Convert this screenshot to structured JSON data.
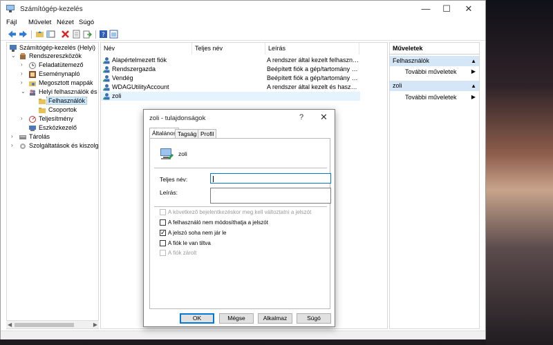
{
  "window": {
    "title": "Számítógép-kezelés",
    "minimize": "—",
    "maximize": "☐",
    "close": "✕"
  },
  "menu": {
    "items": [
      "Fájl",
      "Művelet",
      "Nézet",
      "Súgó"
    ]
  },
  "toolbar": {
    "icons": [
      "back-icon",
      "forward-icon",
      "up-folder-icon",
      "show-hide-tree-icon",
      "delete-icon",
      "properties-icon",
      "export-icon",
      "help-icon",
      "console-icon"
    ]
  },
  "tree": {
    "root": "Számítógép-kezelés (Helyi)",
    "system_tools": "Rendszereszközök",
    "task_scheduler": "Feladatütemező",
    "event_viewer": "Eseménynapló",
    "shared_folders": "Megosztott mappák",
    "local_users_groups": "Helyi felhasználók és cs",
    "users": "Felhasználók",
    "groups": "Csoportok",
    "performance": "Teljesítmény",
    "device_manager": "Eszközkezelő",
    "storage": "Tárolás",
    "services_apps": "Szolgáltatások és kiszolgáló"
  },
  "list": {
    "columns": [
      "Név",
      "Teljes név",
      "Leírás"
    ],
    "rows": [
      {
        "name": "Alapértelmezett fiók",
        "full_name": "",
        "description": "A rendszer által kezelt felhasználói..."
      },
      {
        "name": "Rendszergazda",
        "full_name": "",
        "description": "Beépített fiók a gép/tartomány fel..."
      },
      {
        "name": "Vendég",
        "full_name": "",
        "description": "Beépített fiók a gép/tartomány ve..."
      },
      {
        "name": "WDAGUtilityAccount",
        "full_name": "",
        "description": "A rendszer által kezelt és használt ..."
      },
      {
        "name": "zoli",
        "full_name": "",
        "description": ""
      }
    ]
  },
  "actions": {
    "title": "Műveletek",
    "sections": [
      {
        "header": "Felhasználók",
        "item": "További műveletek"
      },
      {
        "header": "zoli",
        "item": "További műveletek"
      }
    ]
  },
  "dialog": {
    "title": "zoli - tulajdonságok",
    "help": "?",
    "close": "✕",
    "tabs": [
      "Általános",
      "Tagság",
      "Profil"
    ],
    "username": "zoli",
    "full_name_label": "Teljes név:",
    "full_name_value": "",
    "description_label": "Leírás:",
    "description_value": "",
    "checkboxes": [
      {
        "label": "A következő bejelentkezéskor meg kell változtatni a jelszót",
        "checked": false,
        "disabled": true
      },
      {
        "label": "A felhasználó nem módosíthatja a jelszót",
        "checked": false,
        "disabled": false
      },
      {
        "label": "A jelszó soha nem jár le",
        "checked": true,
        "disabled": false
      },
      {
        "label": "A fiók le van tiltva",
        "checked": false,
        "disabled": false
      },
      {
        "label": "A fiók zárolt",
        "checked": false,
        "disabled": true
      }
    ],
    "buttons": {
      "ok": "OK",
      "cancel": "Mégse",
      "apply": "Alkalmaz",
      "help": "Súgó"
    }
  }
}
